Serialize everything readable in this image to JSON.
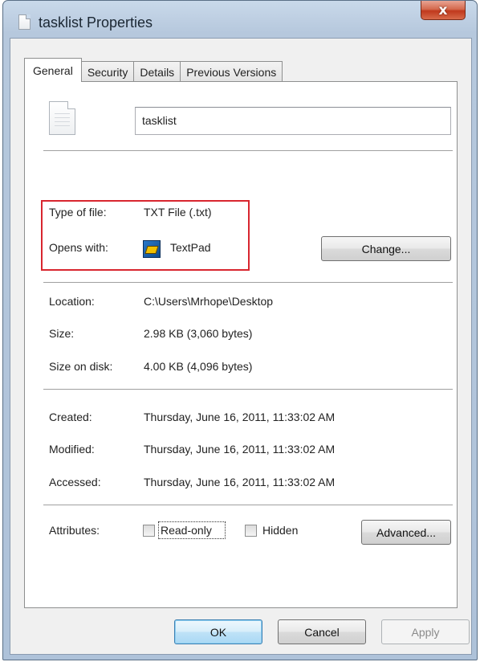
{
  "window": {
    "title": "tasklist Properties",
    "close_glyph": "x"
  },
  "tabs": [
    {
      "label": "General",
      "active": true
    },
    {
      "label": "Security",
      "active": false
    },
    {
      "label": "Details",
      "active": false
    },
    {
      "label": "Previous Versions",
      "active": false
    }
  ],
  "general": {
    "file_name": "tasklist",
    "type_of_file_label": "Type of file:",
    "type_of_file_value": "TXT File (.txt)",
    "opens_with_label": "Opens with:",
    "opens_with_value": "TextPad",
    "change_button": "Change...",
    "location_label": "Location:",
    "location_value": "C:\\Users\\Mrhope\\Desktop",
    "size_label": "Size:",
    "size_value": "2.98 KB (3,060 bytes)",
    "size_on_disk_label": "Size on disk:",
    "size_on_disk_value": "4.00 KB (4,096 bytes)",
    "created_label": "Created:",
    "created_value": "Thursday, June 16, 2011, 11:33:02 AM",
    "modified_label": "Modified:",
    "modified_value": "Thursday, June 16, 2011, 11:33:02 AM",
    "accessed_label": "Accessed:",
    "accessed_value": "Thursday, June 16, 2011, 11:33:02 AM",
    "attributes_label": "Attributes:",
    "read_only_label": "Read-only",
    "read_only_checked": false,
    "hidden_label": "Hidden",
    "hidden_checked": false,
    "advanced_button": "Advanced..."
  },
  "footer": {
    "ok_button": "OK",
    "cancel_button": "Cancel",
    "apply_button": "Apply"
  },
  "icons": {
    "title": "text-file-icon",
    "file": "text-document-icon",
    "opens_with": "textpad-app-icon"
  },
  "colors": {
    "highlight_box": "#d8262f",
    "close_button": "#c0391d",
    "default_button_border": "#3c7fb1"
  }
}
